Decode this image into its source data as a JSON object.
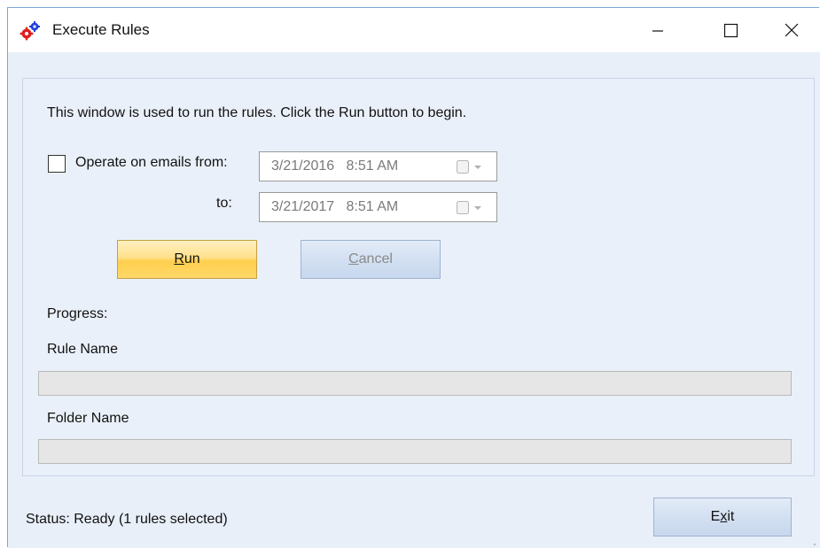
{
  "window": {
    "title": "Execute Rules"
  },
  "titlebar": {
    "minimize_icon": "minimize-icon",
    "maximize_icon": "maximize-icon",
    "close_icon": "close-icon"
  },
  "intro_text": "This window is used to run the rules. Click the Run button to begin.",
  "filter": {
    "checkbox_label": "Operate on emails from:",
    "checked": false,
    "from_value": "3/21/2016   8:51 AM",
    "to_label": "to:",
    "to_value": "3/21/2017   8:51 AM"
  },
  "buttons": {
    "run": {
      "mnemonic": "R",
      "rest": "un"
    },
    "cancel": {
      "mnemonic": "C",
      "rest": "ancel"
    },
    "exit": {
      "pre": "E",
      "mnemonic": "x",
      "rest": "it"
    }
  },
  "progress": {
    "heading": "Progress:",
    "rule_label": "Rule Name",
    "rule_fraction": 0,
    "folder_label": "Folder Name",
    "folder_fraction": 0
  },
  "status_text": "Status: Ready (1 rules selected)",
  "colors": {
    "client_background": "#e8eff9",
    "run_button": "#ffd86a",
    "progress_fill": "#06b025"
  }
}
